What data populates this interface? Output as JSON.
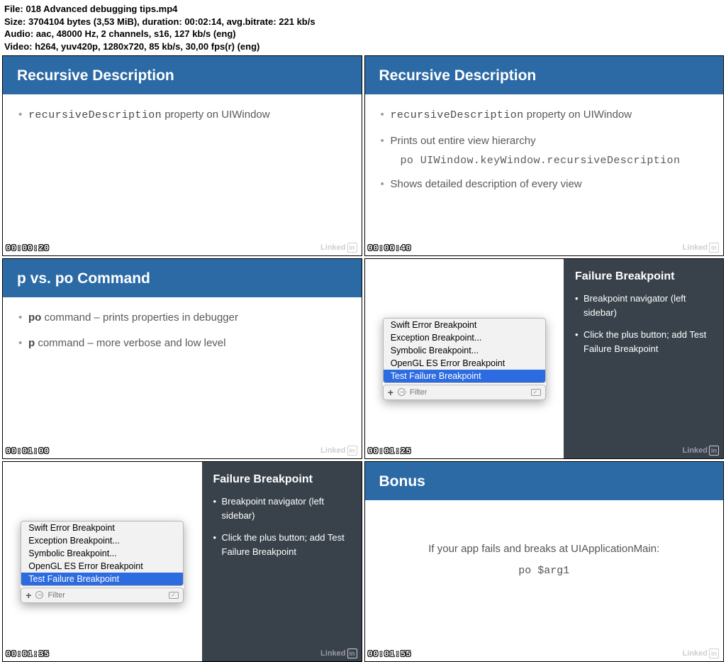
{
  "meta": {
    "line1_label": "File: ",
    "file": "018 Advanced debugging tips.mp4",
    "line2_label": "Size: ",
    "size": "3704104 bytes (3,53 MiB), duration: 00:02:14, avg.bitrate: 221 kb/s",
    "line3_label": "Audio: ",
    "audio": "aac, 48000 Hz, 2 channels, s16, 127 kb/s (eng)",
    "line4_label": "Video: ",
    "video": "h264, yuv420p, 1280x720, 85 kb/s, 30,00 fps(r) (eng)"
  },
  "linkedin": {
    "word": "Linked",
    "in": "in"
  },
  "panel1": {
    "title": "Recursive Description",
    "b1a": "recursiveDescription",
    "b1b": " property on UIWindow",
    "ts": "00:00:20"
  },
  "panel2": {
    "title": "Recursive Description",
    "b1a": "recursiveDescription",
    "b1b": " property on UIWindow",
    "b2": "Prints out entire view hierarchy",
    "code": "po UIWindow.keyWindow.recursiveDescription",
    "b3": "Shows detailed description of every view",
    "ts": "00:00:40"
  },
  "panel3": {
    "title": "p vs. po Command",
    "b1a": "po",
    "b1b": " command – prints properties in debugger",
    "b2a": "p",
    "b2b": " command – more verbose and low level",
    "ts": "00:01:00"
  },
  "bpmenu": {
    "items": [
      "Swift Error Breakpoint",
      "Exception Breakpoint...",
      "Symbolic Breakpoint...",
      "OpenGL ES Error Breakpoint",
      "Test Failure Breakpoint"
    ],
    "filter": "Filter"
  },
  "failpanel": {
    "title": "Failure Breakpoint",
    "b1": "Breakpoint navigator (left sidebar)",
    "b2": "Click the plus button; add  Test Failure Breakpoint"
  },
  "panel4": {
    "ts": "00:01:25"
  },
  "panel5": {
    "ts": "00:01:35"
  },
  "panel6": {
    "title": "Bonus",
    "line1": "If your app fails and breaks at UIApplicationMain:",
    "line2": "po $arg1",
    "ts": "00:01:55"
  }
}
